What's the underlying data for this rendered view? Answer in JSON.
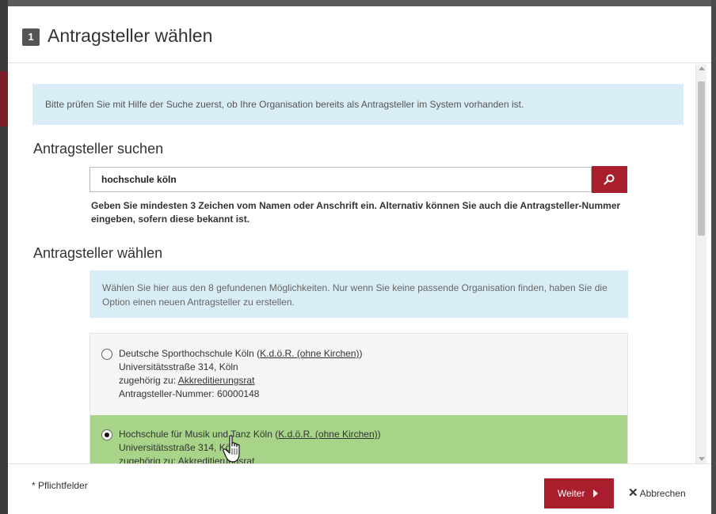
{
  "dialog": {
    "step_number": "1",
    "title": "Antragsteller wählen"
  },
  "info_text": "Bitte prüfen Sie mit Hilfe der Suche zuerst, ob Ihre Organisation bereits als Antragsteller im System vorhanden ist.",
  "search": {
    "heading": "Antragsteller suchen",
    "value": "hochschule köln",
    "button_icon": "search-icon",
    "hint": "Geben Sie mindesten 3 Zeichen vom Namen oder Anschrift ein. Alternativ können Sie auch die Antragsteller-Nummer eingeben, sofern diese bekannt ist."
  },
  "select": {
    "heading": "Antragsteller wählen",
    "info": "Wählen Sie hier aus den 8 gefundenen Möglichkeiten. Nur wenn Sie keine passende Organisation finden, haben Sie die Option einen neuen Antragsteller zu erstellen.",
    "results": [
      {
        "name": "Deutsche Sporthochschule Köln",
        "type": "K.d.ö.R. (ohne Kirchen)",
        "address": "Universitätsstraße 314,  Köln",
        "belongs_prefix": "zugehörig zu: ",
        "belongs_to": "Akkreditierungsrat",
        "number_label": "Antragsteller-Nummer: 60000148",
        "selected": false
      },
      {
        "name": "Hochschule für Musik und Tanz Köln",
        "type": "K.d.ö.R. (ohne Kirchen)",
        "address": "Universitätsstraße 314,  Köln",
        "belongs_prefix": "zugehörig zu: ",
        "belongs_to": "Akkreditierungsrat",
        "selected": true
      }
    ],
    "selected_color": "#a8d48a"
  },
  "footer": {
    "required_note": "* Pflichtfelder",
    "next_label": "Weiter",
    "cancel_label": "Abbrechen"
  },
  "colors": {
    "accent": "#a91e2c",
    "info_bg": "#d9edf7"
  }
}
